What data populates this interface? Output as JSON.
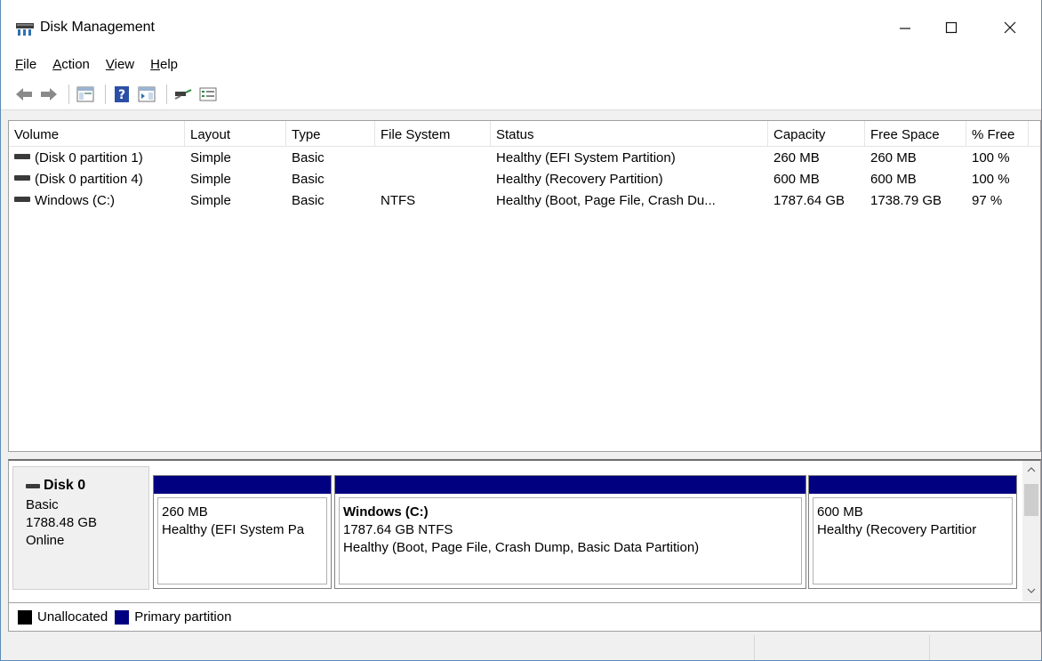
{
  "window": {
    "title": "Disk Management"
  },
  "menu": [
    {
      "label_first": "F",
      "label_rest": "ile"
    },
    {
      "label_first": "A",
      "label_rest": "ction"
    },
    {
      "label_first": "V",
      "label_rest": "iew"
    },
    {
      "label_first": "H",
      "label_rest": "elp"
    }
  ],
  "toolbar": {
    "buttons": [
      "back-arrow-icon",
      "forward-arrow-icon",
      "show-hide-console-tree-icon",
      "help-icon",
      "show-hide-action-pane-icon",
      "connect-icon",
      "properties-icon"
    ]
  },
  "volume_list": {
    "columns": [
      "Volume",
      "Layout",
      "Type",
      "File System",
      "Status",
      "Capacity",
      "Free Space",
      "% Free"
    ],
    "rows": [
      {
        "volume": "(Disk 0 partition 1)",
        "layout": "Simple",
        "type": "Basic",
        "fs": "",
        "status": "Healthy (EFI System Partition)",
        "capacity": "260 MB",
        "free": "260 MB",
        "pct": "100 %"
      },
      {
        "volume": "(Disk 0 partition 4)",
        "layout": "Simple",
        "type": "Basic",
        "fs": "",
        "status": "Healthy (Recovery Partition)",
        "capacity": "600 MB",
        "free": "600 MB",
        "pct": "100 %"
      },
      {
        "volume": "Windows (C:)",
        "layout": "Simple",
        "type": "Basic",
        "fs": "NTFS",
        "status": "Healthy (Boot, Page File, Crash Du...",
        "capacity": "1787.64 GB",
        "free": "1738.79 GB",
        "pct": "97 %"
      }
    ]
  },
  "disk": {
    "name": "Disk 0",
    "type": "Basic",
    "size": "1788.48 GB",
    "state": "Online",
    "partitions": [
      {
        "title": "",
        "line1": "260 MB",
        "line2": "Healthy (EFI System Pa"
      },
      {
        "title": "Windows  (C:)",
        "line1": "1787.64 GB NTFS",
        "line2": "Healthy (Boot, Page File, Crash Dump, Basic Data Partition)"
      },
      {
        "title": "",
        "line1": "600 MB",
        "line2": "Healthy (Recovery Partitior"
      }
    ]
  },
  "legend": [
    {
      "label": "Unallocated",
      "color": "#000000"
    },
    {
      "label": "Primary partition",
      "color": "#000080"
    }
  ],
  "colors": {
    "partition_bar": "#000080",
    "title_bar": "#ffffff",
    "window_bg": "#f0f0f0"
  }
}
